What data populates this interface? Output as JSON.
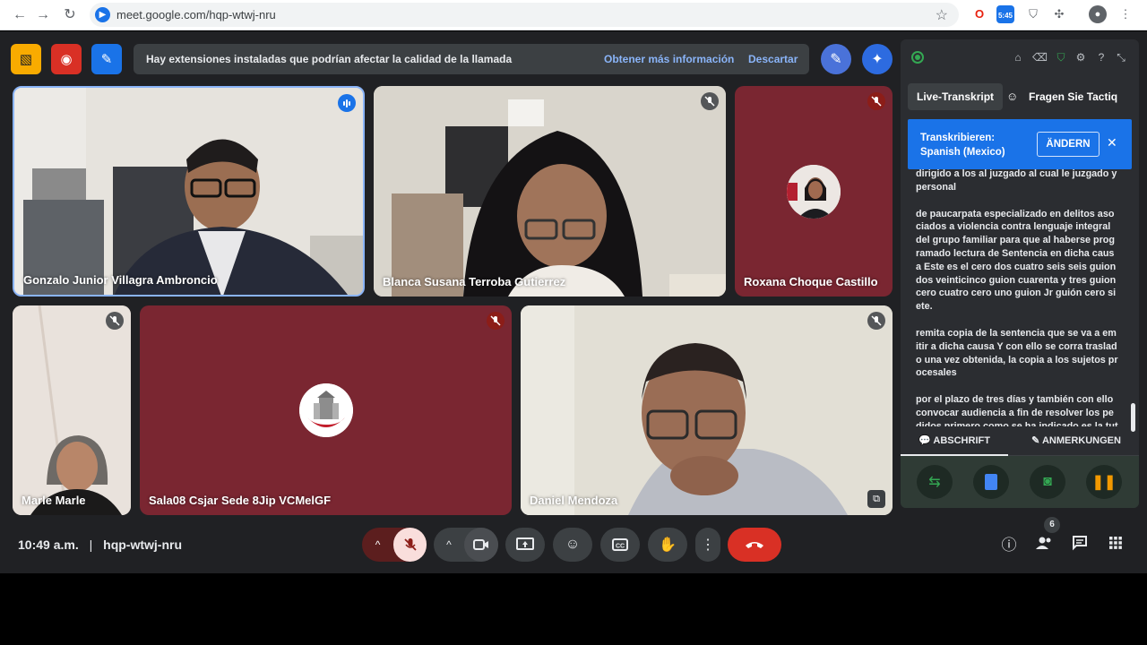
{
  "browser": {
    "url": "meet.google.com/hqp-wtwj-nru",
    "ext_time": "5:45"
  },
  "banner": {
    "text": "Hay extensiones instaladas que podrían afectar la calidad de la llamada",
    "more_info": "Obtener más información",
    "dismiss": "Descartar"
  },
  "participants": [
    {
      "name": "Gonzalo Junior Villagra Ambroncio",
      "speaking": true
    },
    {
      "name": "Blanca Susana Terroba Gutierrez",
      "muted": true
    },
    {
      "name": "Roxana Choque Castillo",
      "muted": true
    },
    {
      "name": "Marle Marle",
      "muted": true
    },
    {
      "name": "Sala08 Csjar Sede 8Jip VCMelGF",
      "muted": true
    },
    {
      "name": "Daniel Mendoza",
      "muted": true
    }
  ],
  "meeting": {
    "time": "10:49 a.m.",
    "separator": "|",
    "code": "hqp-wtwj-nru",
    "participant_count": "6"
  },
  "panel": {
    "tab_live": "Live-Transkript",
    "tab_ask": "Fragen Sie Tactiq AI",
    "transcribe_label": "Transkribieren:",
    "transcribe_lang": "Spanish (Mexico)",
    "change_button": "ÄNDERN",
    "transcript": [
      "dirigido a los al juzgado al cual le juzgado y personal",
      "de paucarpata especializado en delitos asociados a violencia contra lenguaje integral del grupo familiar para que al haberse programado lectura de Sentencia en dicha causa Este es el cero dos cuatro seis seis guion dos veinticinco guion cuarenta y tres guion cero cuatro cero uno guion Jr guión cero siete.",
      "remita copia de la sentencia que se va a emitir a dicha causa Y con ello se corra traslado una vez obtenida, la copia a los sujetos procesales",
      "por el plazo de tres días y también con ello convocar audiencia a fin de resolver los pedidos primero como se ha indicado es la tutela de derechos."
    ],
    "tab_transcript": "ABSCHRIFT",
    "tab_notes": "ANMERKUNGEN"
  }
}
